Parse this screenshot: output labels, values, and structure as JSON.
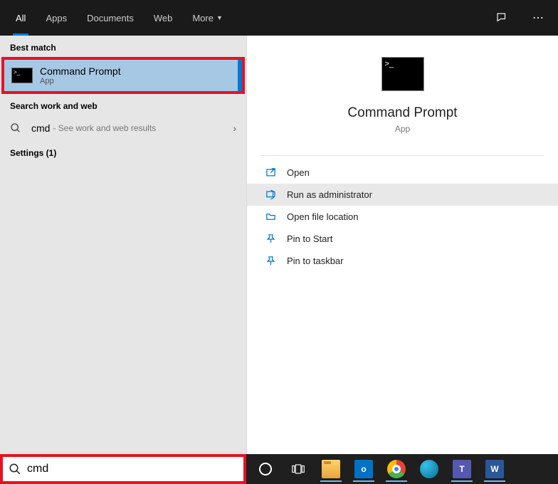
{
  "tabs": {
    "all": "All",
    "apps": "Apps",
    "documents": "Documents",
    "web": "Web",
    "more": "More"
  },
  "sections": {
    "best_match": "Best match",
    "search_work_web": "Search work and web",
    "settings": "Settings (1)"
  },
  "result": {
    "title": "Command Prompt",
    "subtitle": "App"
  },
  "web": {
    "term": "cmd",
    "hint": " - See work and web results"
  },
  "preview": {
    "title": "Command Prompt",
    "subtitle": "App"
  },
  "actions": {
    "open": "Open",
    "run_admin": "Run as administrator",
    "open_loc": "Open file location",
    "pin_start": "Pin to Start",
    "pin_taskbar": "Pin to taskbar"
  },
  "search": {
    "value": "cmd"
  }
}
